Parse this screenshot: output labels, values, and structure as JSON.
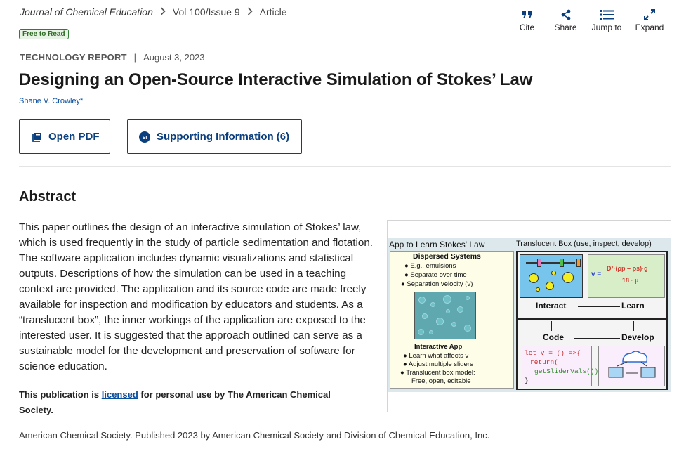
{
  "breadcrumb": {
    "journal": "Journal of Chemical Education",
    "issue": "Vol 100/Issue 9",
    "section": "Article"
  },
  "badge": {
    "free": "Free to Read"
  },
  "toolbar": {
    "cite": "Cite",
    "share": "Share",
    "jump": "Jump to",
    "expand": "Expand"
  },
  "article": {
    "type": "TECHNOLOGY REPORT",
    "date": "August 3, 2023",
    "title": "Designing an Open-Source Interactive Simulation of Stokes’ Law",
    "author": "Shane V. Crowley*"
  },
  "buttons": {
    "pdf": "Open PDF",
    "si": "Supporting Information (6)",
    "si_icon_text": "SI"
  },
  "abstract": {
    "heading": "Abstract",
    "body": "This paper outlines the design of an interactive simulation of Stokes’ law, which is used frequently in the study of particle sedimentation and flotation. The software application includes dynamic visualizations and statistical outputs. Descriptions of how the simulation can be used in a teaching context are provided. The application and its source code are made freely available for inspection and modification by educators and students. As a “translucent box”, the inner workings of the application are exposed to the interested user. It is suggested that the approach outlined can serve as a sustainable model for the development and preservation of software for science education."
  },
  "license": {
    "prefix": "This publication is ",
    "link": "licensed",
    "suffix": " for personal use by The American Chemical Society."
  },
  "copyright": "American Chemical Society. Published 2023 by American Chemical Society and Division of Chemical Education, Inc.",
  "toc_graphic": {
    "left_heading": "App to Learn Stokes' Law",
    "right_heading": "Translucent Box (use, inspect, develop)",
    "dispersed_title": "Dispersed Systems",
    "dispersed_items": [
      "● E.g., emulsions",
      "● Separate over time",
      "● Separation velocity (v)"
    ],
    "app_title": "Interactive App",
    "app_items": [
      "● Learn what affects v",
      "● Adjust multiple sliders",
      "● Translucent box model:",
      "Free, open, editable"
    ],
    "formula_lhs": "v =",
    "formula_num": "D²·(ρp – ρs)·g",
    "formula_den": "18 · μ",
    "interact": "Interact",
    "learn": "Learn",
    "code": "Code",
    "develop": "Develop",
    "code_lines": [
      "let v = () =>{",
      "return(",
      "getSliderVals())",
      "}"
    ]
  },
  "colors": {
    "brand": "#0b3f7d",
    "link": "#0b4f9c",
    "free_badge": "#2e7d32"
  }
}
